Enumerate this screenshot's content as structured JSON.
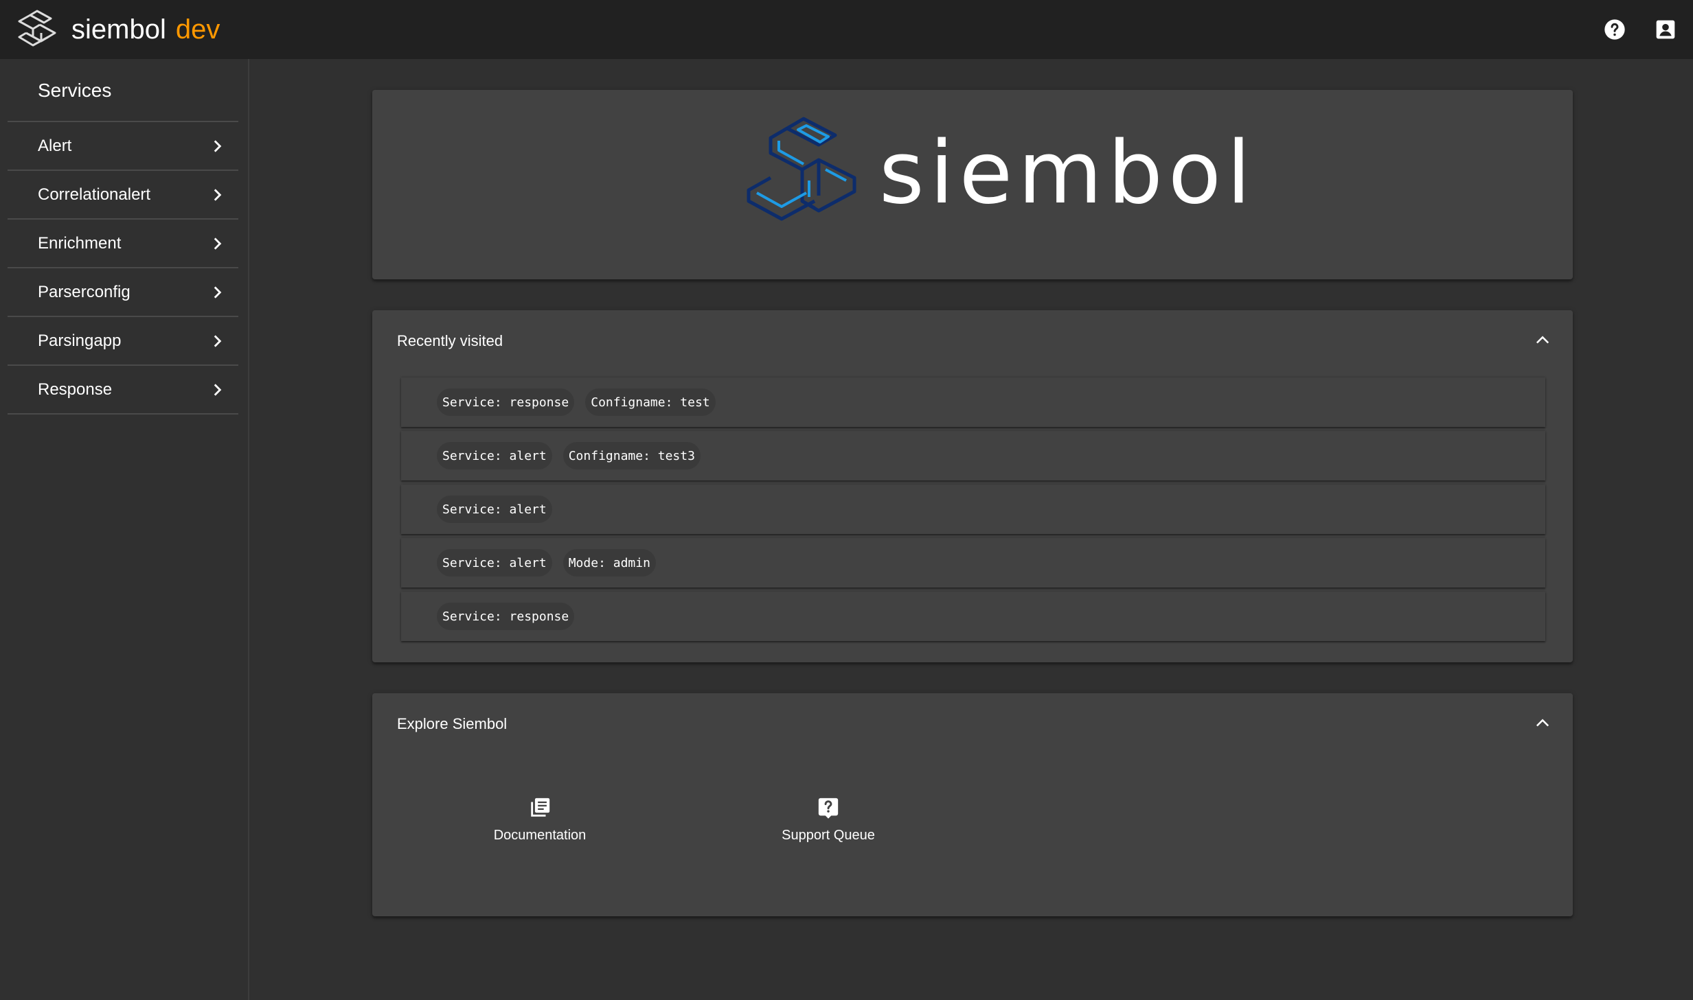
{
  "app": {
    "name": "siembol",
    "environment": "dev",
    "environment_color": "#ff9800",
    "hero_name": "siembol"
  },
  "header": {
    "icons": [
      "help-icon",
      "account-box-icon"
    ]
  },
  "sidebar": {
    "title": "Services",
    "items": [
      {
        "label": "Alert"
      },
      {
        "label": "Correlationalert"
      },
      {
        "label": "Enrichment"
      },
      {
        "label": "Parserconfig"
      },
      {
        "label": "Parsingapp"
      },
      {
        "label": "Response"
      }
    ]
  },
  "recent": {
    "title": "Recently visited",
    "items": [
      {
        "chips": [
          "Service: response",
          "Configname: test"
        ]
      },
      {
        "chips": [
          "Service: alert",
          "Configname: test3"
        ]
      },
      {
        "chips": [
          "Service: alert"
        ]
      },
      {
        "chips": [
          "Service: alert",
          "Mode: admin"
        ]
      },
      {
        "chips": [
          "Service: response"
        ]
      }
    ]
  },
  "explore": {
    "title": "Explore Siembol",
    "links": [
      {
        "label": "Documentation",
        "icon": "library-books-icon"
      },
      {
        "label": "Support Queue",
        "icon": "live-help-icon"
      }
    ]
  },
  "colors": {
    "topbar": "#212121",
    "background": "#303030",
    "card": "#424242",
    "logo_blue": "#1e88e5",
    "logo_dark": "#0d2c6b"
  }
}
